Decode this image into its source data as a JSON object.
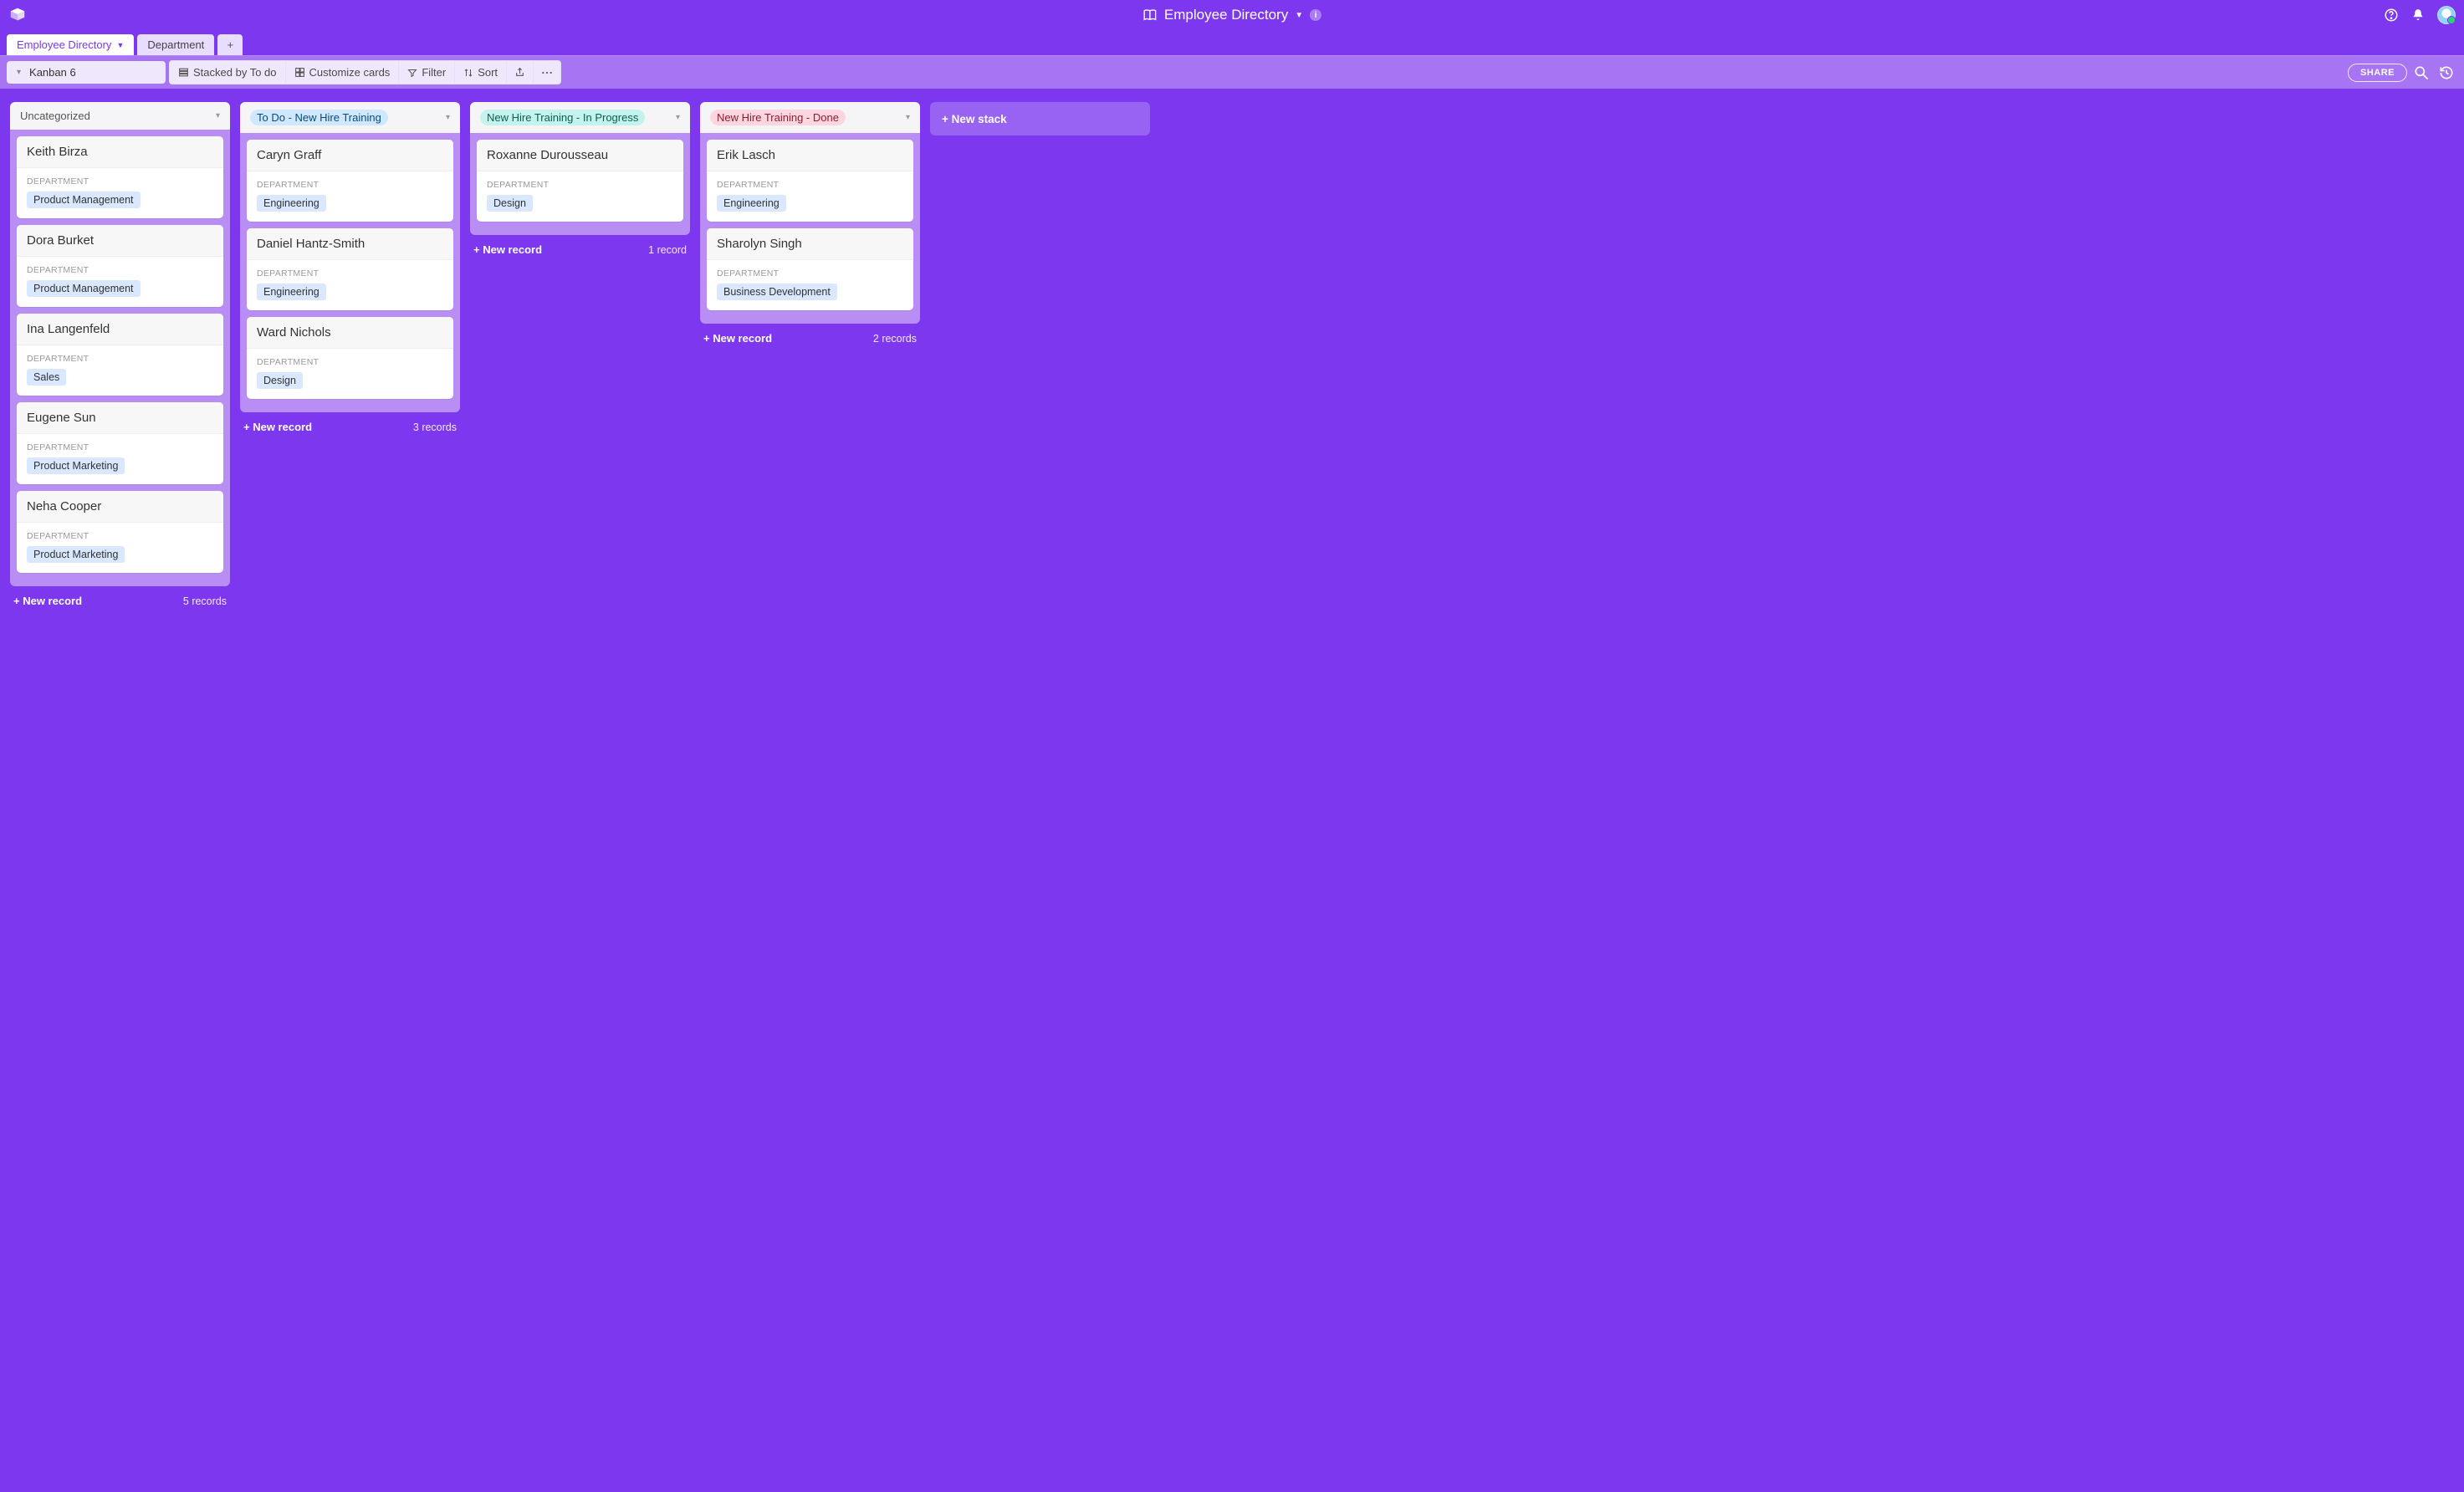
{
  "app": {
    "title": "Employee Directory"
  },
  "tabs": {
    "primary": "Employee Directory",
    "secondary": "Department",
    "add": "+"
  },
  "view": {
    "name": "Kanban 6"
  },
  "toolbar": {
    "stacked": "Stacked by To do",
    "customize": "Customize cards",
    "filter": "Filter",
    "sort": "Sort",
    "share": "SHARE"
  },
  "labels": {
    "department": "DEPARTMENT",
    "new_record": "+ New record",
    "new_stack": "+ New stack"
  },
  "stacks": [
    {
      "title": "Uncategorized",
      "pillClass": "pill-uncat",
      "count": "5 records",
      "cards": [
        {
          "name": "Keith Birza",
          "dept": "Product Management"
        },
        {
          "name": "Dora Burket",
          "dept": "Product Management"
        },
        {
          "name": "Ina Langenfeld",
          "dept": "Sales"
        },
        {
          "name": "Eugene Sun",
          "dept": "Product Marketing"
        },
        {
          "name": "Neha Cooper",
          "dept": "Product Marketing"
        }
      ]
    },
    {
      "title": "To Do - New Hire Training",
      "pillClass": "pill-blue",
      "count": "3 records",
      "cards": [
        {
          "name": "Caryn Graff",
          "dept": "Engineering"
        },
        {
          "name": "Daniel Hantz-Smith",
          "dept": "Engineering"
        },
        {
          "name": "Ward Nichols",
          "dept": "Design"
        }
      ]
    },
    {
      "title": "New Hire Training - In Progress",
      "pillClass": "pill-teal",
      "count": "1 record",
      "cards": [
        {
          "name": "Roxanne Durousseau",
          "dept": "Design"
        }
      ]
    },
    {
      "title": "New Hire Training - Done",
      "pillClass": "pill-pink",
      "count": "2 records",
      "cards": [
        {
          "name": "Erik Lasch",
          "dept": "Engineering"
        },
        {
          "name": "Sharolyn Singh",
          "dept": "Business Development"
        }
      ]
    }
  ]
}
